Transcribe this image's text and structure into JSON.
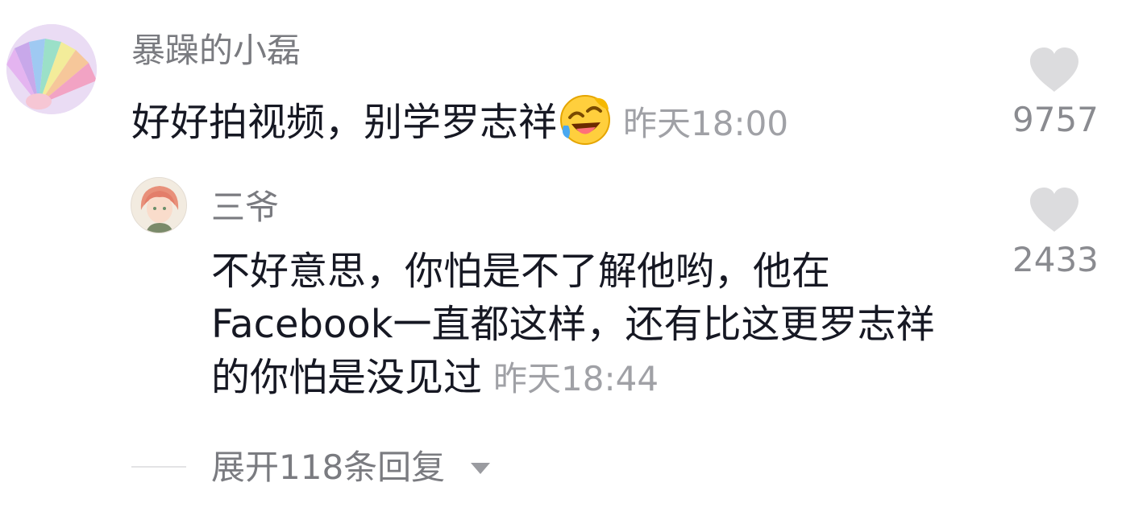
{
  "comment": {
    "author": "暴躁的小磊",
    "text": "好好拍视频，别学罗志祥",
    "emoji": "rolling-laugh-emoji",
    "time": "昨天18:00",
    "likes": "9757"
  },
  "reply": {
    "author": "三爷",
    "lines": [
      "不好意思，你怕是不了解他哟，他在",
      "Facebook一直都这样，还有比这更罗志祥",
      "的你怕是没见过"
    ],
    "time": "昨天18:44",
    "likes": "2433"
  },
  "expand": {
    "label": "展开118条回复",
    "icon": "caret-down-icon"
  },
  "colors": {
    "text": "#161823",
    "secondary": "#7a7b80",
    "time": "#a0a1a6",
    "heart": "#dcdcde"
  }
}
